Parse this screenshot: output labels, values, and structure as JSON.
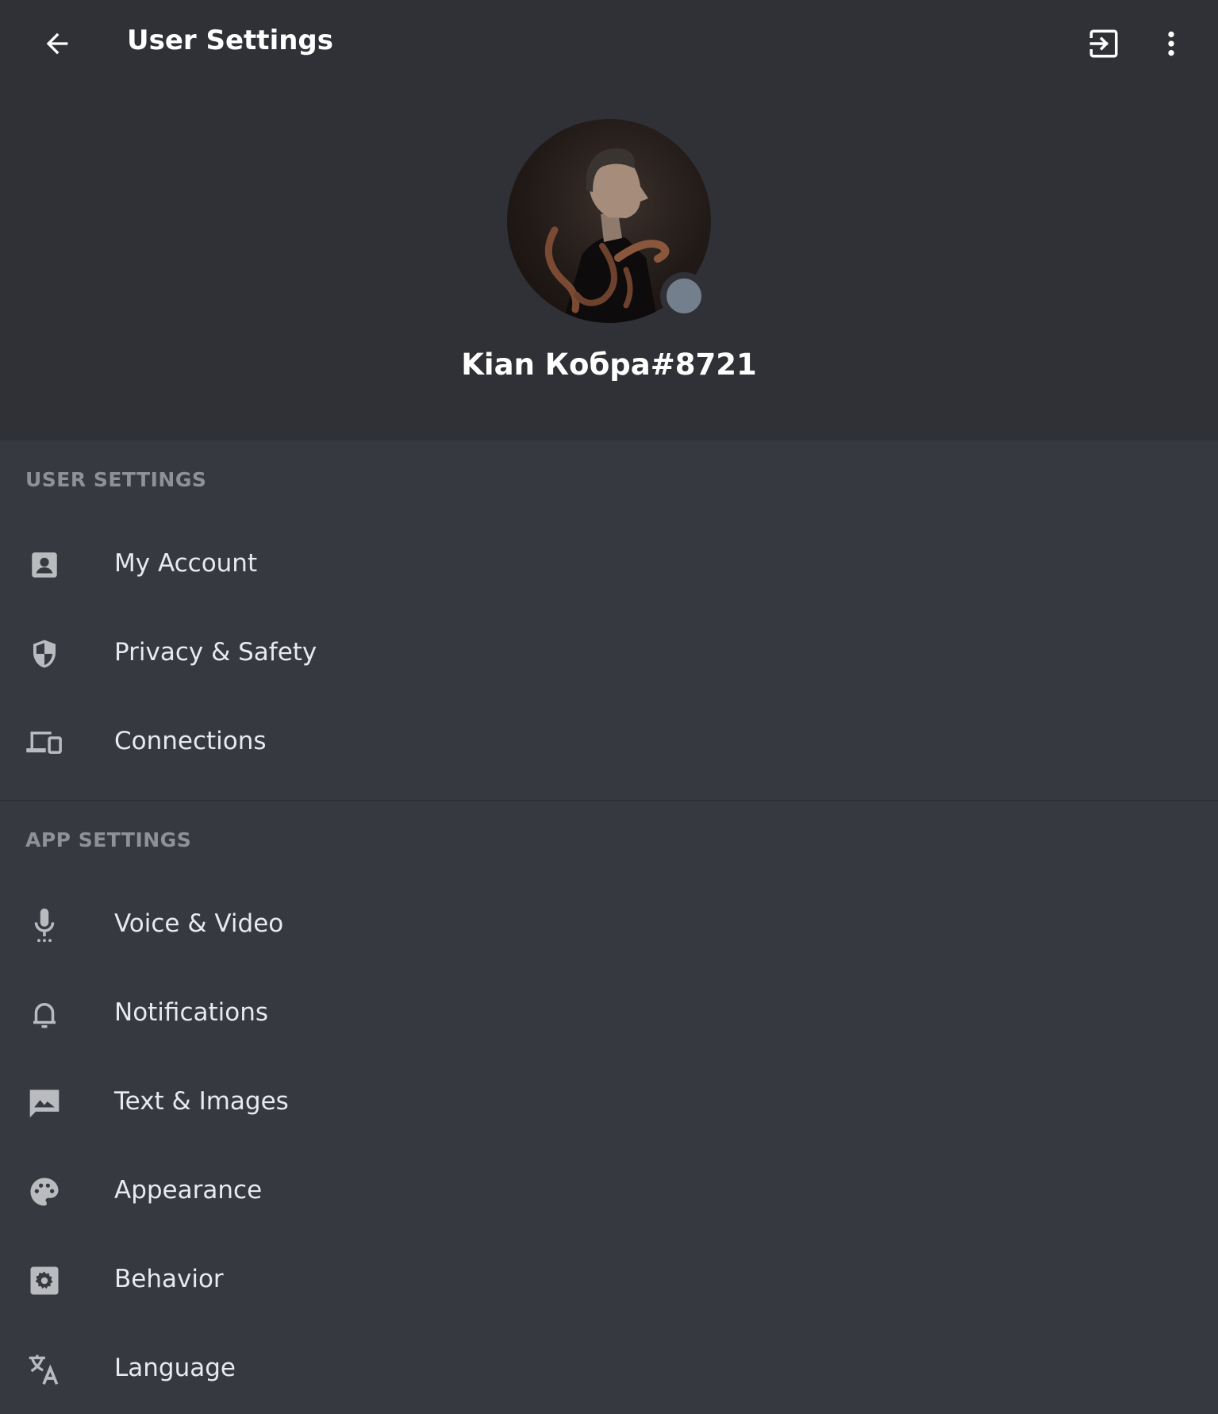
{
  "topbar": {
    "title": "User Settings",
    "back_icon": "arrow-left-icon",
    "logout_icon": "logout-icon",
    "more_icon": "more-vertical-icon"
  },
  "profile": {
    "username": "Kian Кобра#8721",
    "status": "offline",
    "status_color": "#747f8d"
  },
  "user_settings": {
    "label": "USER SETTINGS",
    "items": [
      {
        "label": "My Account",
        "icon": "account-icon"
      },
      {
        "label": "Privacy & Safety",
        "icon": "shield-icon"
      },
      {
        "label": "Connections",
        "icon": "devices-icon"
      }
    ]
  },
  "app_settings": {
    "label": "APP SETTINGS",
    "items": [
      {
        "label": "Voice & Video",
        "icon": "microphone-icon"
      },
      {
        "label": "Notifications",
        "icon": "bell-icon"
      },
      {
        "label": "Text & Images",
        "icon": "image-icon"
      },
      {
        "label": "Appearance",
        "icon": "palette-icon"
      },
      {
        "label": "Behavior",
        "icon": "gear-icon"
      },
      {
        "label": "Language",
        "icon": "translate-icon"
      }
    ]
  },
  "colors": {
    "header_bg": "#2f3136",
    "body_bg": "#363940",
    "section_label": "#8e9297",
    "icon": "#b9bbbe"
  }
}
